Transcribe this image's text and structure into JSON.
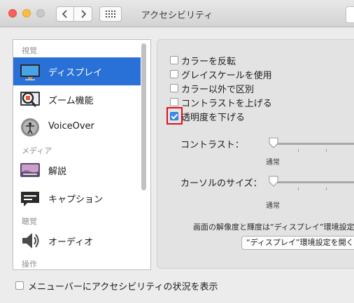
{
  "window": {
    "title": "アクセシビリティ"
  },
  "sidebar": {
    "sections": [
      {
        "label": "視覚"
      },
      {
        "label": "メディア"
      },
      {
        "label": "聴覚"
      },
      {
        "label": "操作"
      }
    ],
    "items": [
      {
        "label": "ディスプレイ",
        "icon": "display-icon",
        "selected": true
      },
      {
        "label": "ズーム機能",
        "icon": "zoom-icon"
      },
      {
        "label": "VoiceOver",
        "icon": "voiceover-icon"
      },
      {
        "label": "解説",
        "icon": "descriptions-icon"
      },
      {
        "label": "キャプション",
        "icon": "captions-icon"
      },
      {
        "label": "オーディオ",
        "icon": "audio-icon"
      }
    ]
  },
  "display_options": {
    "checkboxes": [
      {
        "label": "カラーを反転",
        "checked": false
      },
      {
        "label": "グレイスケールを使用",
        "checked": false
      },
      {
        "label": "カラー以外で区別",
        "checked": false
      },
      {
        "label": "コントラストを上げる",
        "checked": false
      },
      {
        "label": "透明度を下げる",
        "checked": true
      }
    ],
    "contrast": {
      "label": "コントラスト：",
      "min_label": "通常",
      "value": 0
    },
    "cursor_size": {
      "label": "カーソルのサイズ：",
      "min_label": "通常",
      "value": 0
    },
    "info_text": "画面の解像度と輝度は“ディスプレイ”環境設定",
    "open_button": "“ディスプレイ”環境設定を開く"
  },
  "footer": {
    "menubar_checkbox": {
      "label": "メニューバーにアクセシビリティの状況を表示",
      "checked": false
    }
  },
  "colors": {
    "selection": "#2970d7",
    "checkbox_checked": "#3d8cf2",
    "highlight": "#e3101a"
  }
}
